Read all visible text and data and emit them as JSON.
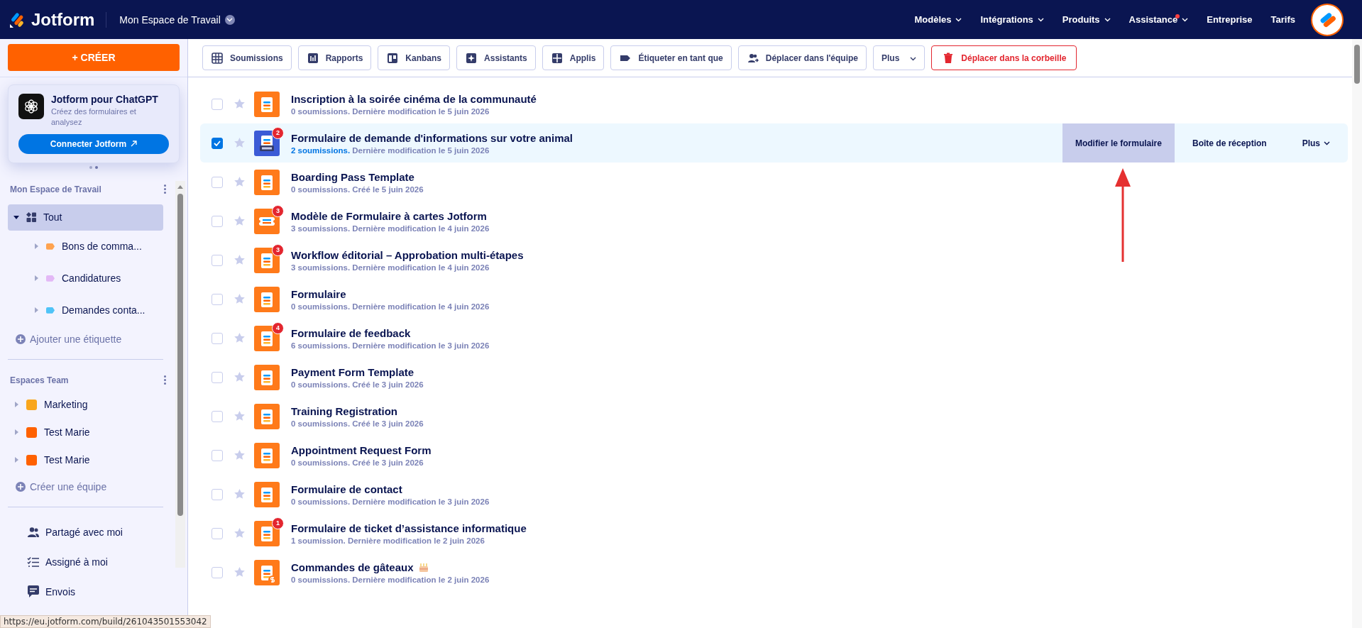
{
  "topbar": {
    "brand": "Jotform",
    "workspace": "Mon Espace de Travail",
    "nav": [
      {
        "label": "Modèles",
        "dropdown": true,
        "dot": false
      },
      {
        "label": "Intégrations",
        "dropdown": true,
        "dot": false
      },
      {
        "label": "Produits",
        "dropdown": true,
        "dot": false
      },
      {
        "label": "Assistance",
        "dropdown": true,
        "dot": true
      },
      {
        "label": "Entreprise",
        "dropdown": false,
        "dot": false
      },
      {
        "label": "Tarifs",
        "dropdown": false,
        "dot": false
      }
    ]
  },
  "sidebar": {
    "create": "+ CRÉER",
    "promo": {
      "title": "Jotform pour ChatGPT",
      "text": "Créez des formulaires et analysez",
      "button": "Connecter Jotform"
    },
    "workspace": {
      "title": "Mon Espace de Travail",
      "items": [
        {
          "label": "Tout",
          "selected": true,
          "expanded": true,
          "children": [
            {
              "label": "Bons de comma...",
              "color": "#ffa34f",
              "expanded": false
            },
            {
              "label": "Candidatures",
              "color": "#e3b8f6",
              "expanded": false
            },
            {
              "label": "Demandes conta...",
              "color": "#4fc3f7",
              "expanded": false
            }
          ]
        }
      ],
      "add": "Ajouter une étiquette"
    },
    "teams": {
      "title": "Espaces Team",
      "items": [
        {
          "label": "Marketing",
          "color": "#f9a61c",
          "expanded": false
        },
        {
          "label": "Test Marie",
          "color": "#ff6100",
          "expanded": false
        },
        {
          "label": "Test Marie",
          "color": "#ff6100",
          "expanded": false
        }
      ],
      "add": "Créer une équipe"
    },
    "links": [
      {
        "label": "Partagé avec moi",
        "kind": "shared"
      },
      {
        "label": "Assigné à moi",
        "kind": "assigned"
      },
      {
        "label": "Envois",
        "kind": "sent"
      }
    ]
  },
  "toolbar": [
    {
      "label": "Soumissions",
      "kind": "table"
    },
    {
      "label": "Rapports",
      "kind": "reports"
    },
    {
      "label": "Kanbans",
      "kind": "kanban"
    },
    {
      "label": "Assistants",
      "kind": "agent"
    },
    {
      "label": "Applis",
      "kind": "apps"
    },
    {
      "label": "Étiqueter en tant que",
      "kind": "tag"
    },
    {
      "label": "Déplacer dans l'équipe",
      "kind": "team"
    },
    {
      "label": "Plus",
      "kind": "more"
    },
    {
      "label": "Déplacer dans la corbeille",
      "kind": "trash"
    }
  ],
  "forms": [
    {
      "title": "Inscription à la soirée cinéma de la communauté",
      "count": "0 soumissions.",
      "date": "Dernière modification le 5 juin 2026",
      "kind": "form",
      "selected": false
    },
    {
      "title": "Formulaire de demande d'informations sur votre animal",
      "count": "2 soumissions.",
      "date": "Dernière modification le 5 juin 2026",
      "kind": "pdf",
      "badge": "2",
      "selected": true
    },
    {
      "title": "Boarding Pass Template",
      "count": "0 soumissions.",
      "date": "Créé le 5 juin 2026",
      "kind": "form",
      "selected": false
    },
    {
      "title": "Modèle de Formulaire à cartes Jotform",
      "count": "3 soumissions.",
      "date": "Dernière modification le 4 juin 2026",
      "kind": "card",
      "badge": "3",
      "selected": false
    },
    {
      "title": "Workflow éditorial – Approbation multi-étapes",
      "count": "3 soumissions.",
      "date": "Dernière modification le 4 juin 2026",
      "kind": "form",
      "badge": "3",
      "selected": false
    },
    {
      "title": "Formulaire",
      "count": "0 soumissions.",
      "date": "Dernière modification le 4 juin 2026",
      "kind": "form",
      "selected": false
    },
    {
      "title": "Formulaire de feedback",
      "count": "6 soumissions.",
      "date": "Dernière modification le 3 juin 2026",
      "kind": "form",
      "badge": "4",
      "selected": false
    },
    {
      "title": "Payment Form Template",
      "count": "0 soumissions.",
      "date": "Créé le 3 juin 2026",
      "kind": "form",
      "selected": false
    },
    {
      "title": "Training Registration",
      "count": "0 soumissions.",
      "date": "Créé le 3 juin 2026",
      "kind": "form",
      "selected": false
    },
    {
      "title": "Appointment Request Form",
      "count": "0 soumissions.",
      "date": "Créé le 3 juin 2026",
      "kind": "form",
      "selected": false
    },
    {
      "title": "Formulaire de contact",
      "count": "0 soumissions.",
      "date": "Dernière modification le 3 juin 2026",
      "kind": "form",
      "selected": false
    },
    {
      "title": "Formulaire de ticket d’assistance informatique",
      "count": "1 soumission.",
      "date": "Dernière modification le 2 juin 2026",
      "kind": "form",
      "badge": "1",
      "selected": false
    },
    {
      "title": "Commandes de gâteaux",
      "count": "0 soumissions.",
      "date": "Dernière modification le 2 juin 2026",
      "kind": "order",
      "selected": false
    }
  ],
  "row_actions": [
    {
      "label": "Modifier le formulaire",
      "highlighted": true
    },
    {
      "label": "Boîte de réception",
      "highlighted": false
    },
    {
      "label": "Plus",
      "highlighted": false
    }
  ],
  "status_url": "https://eu.jotform.com/build/261043501553042"
}
